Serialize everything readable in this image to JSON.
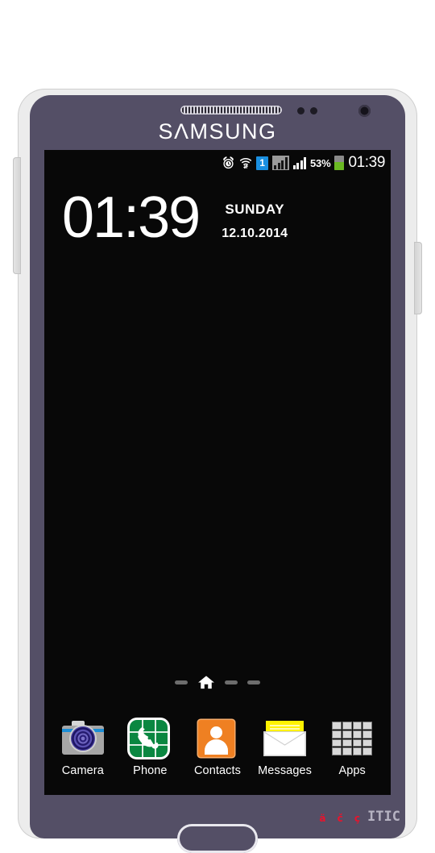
{
  "device": {
    "brand": "SAMSUNG",
    "bezel_color": "#544f66",
    "frame_color": "#ececec",
    "hardware": {
      "earpiece": "earpiece-speaker",
      "front_camera": "front-camera",
      "sensors": "proximity-sensors",
      "volume_rocker": "volume-rocker",
      "power_button": "power-button",
      "home_button": "home-button"
    }
  },
  "status_bar": {
    "alarm_icon": "alarm-clock-icon",
    "wifi_icon": "wifi-icon",
    "sim_badge": "1",
    "signal_1_icon": "signal-bars-icon",
    "signal_2_icon": "signal-bars-icon",
    "battery_percent": "53%",
    "battery_level": 53,
    "battery_color": "#6ab823",
    "time": "01:39"
  },
  "lock_screen": {
    "clock": "01:39",
    "weekday": "SUNDAY",
    "date": "12.10.2014"
  },
  "page_indicator": {
    "home_icon": "home-icon",
    "pages": [
      "dash",
      "home",
      "dash",
      "dash"
    ],
    "active_index": 1
  },
  "dock": {
    "items": [
      {
        "label": "Camera",
        "icon": "camera-icon",
        "color": "#a6a6a6"
      },
      {
        "label": "Phone",
        "icon": "phone-icon",
        "color": "#0a8741"
      },
      {
        "label": "Contacts",
        "icon": "contacts-icon",
        "color": "#ef8022"
      },
      {
        "label": "Messages",
        "icon": "messages-icon",
        "color": "#fff200"
      },
      {
        "label": "Apps",
        "icon": "apps-grid-icon",
        "color": "#d8d8d8"
      }
    ]
  },
  "watermark": {
    "text": "ä č ç",
    "logo": "ITIC",
    "text_color": "#e8142d",
    "logo_color": "#b6b3c2"
  }
}
